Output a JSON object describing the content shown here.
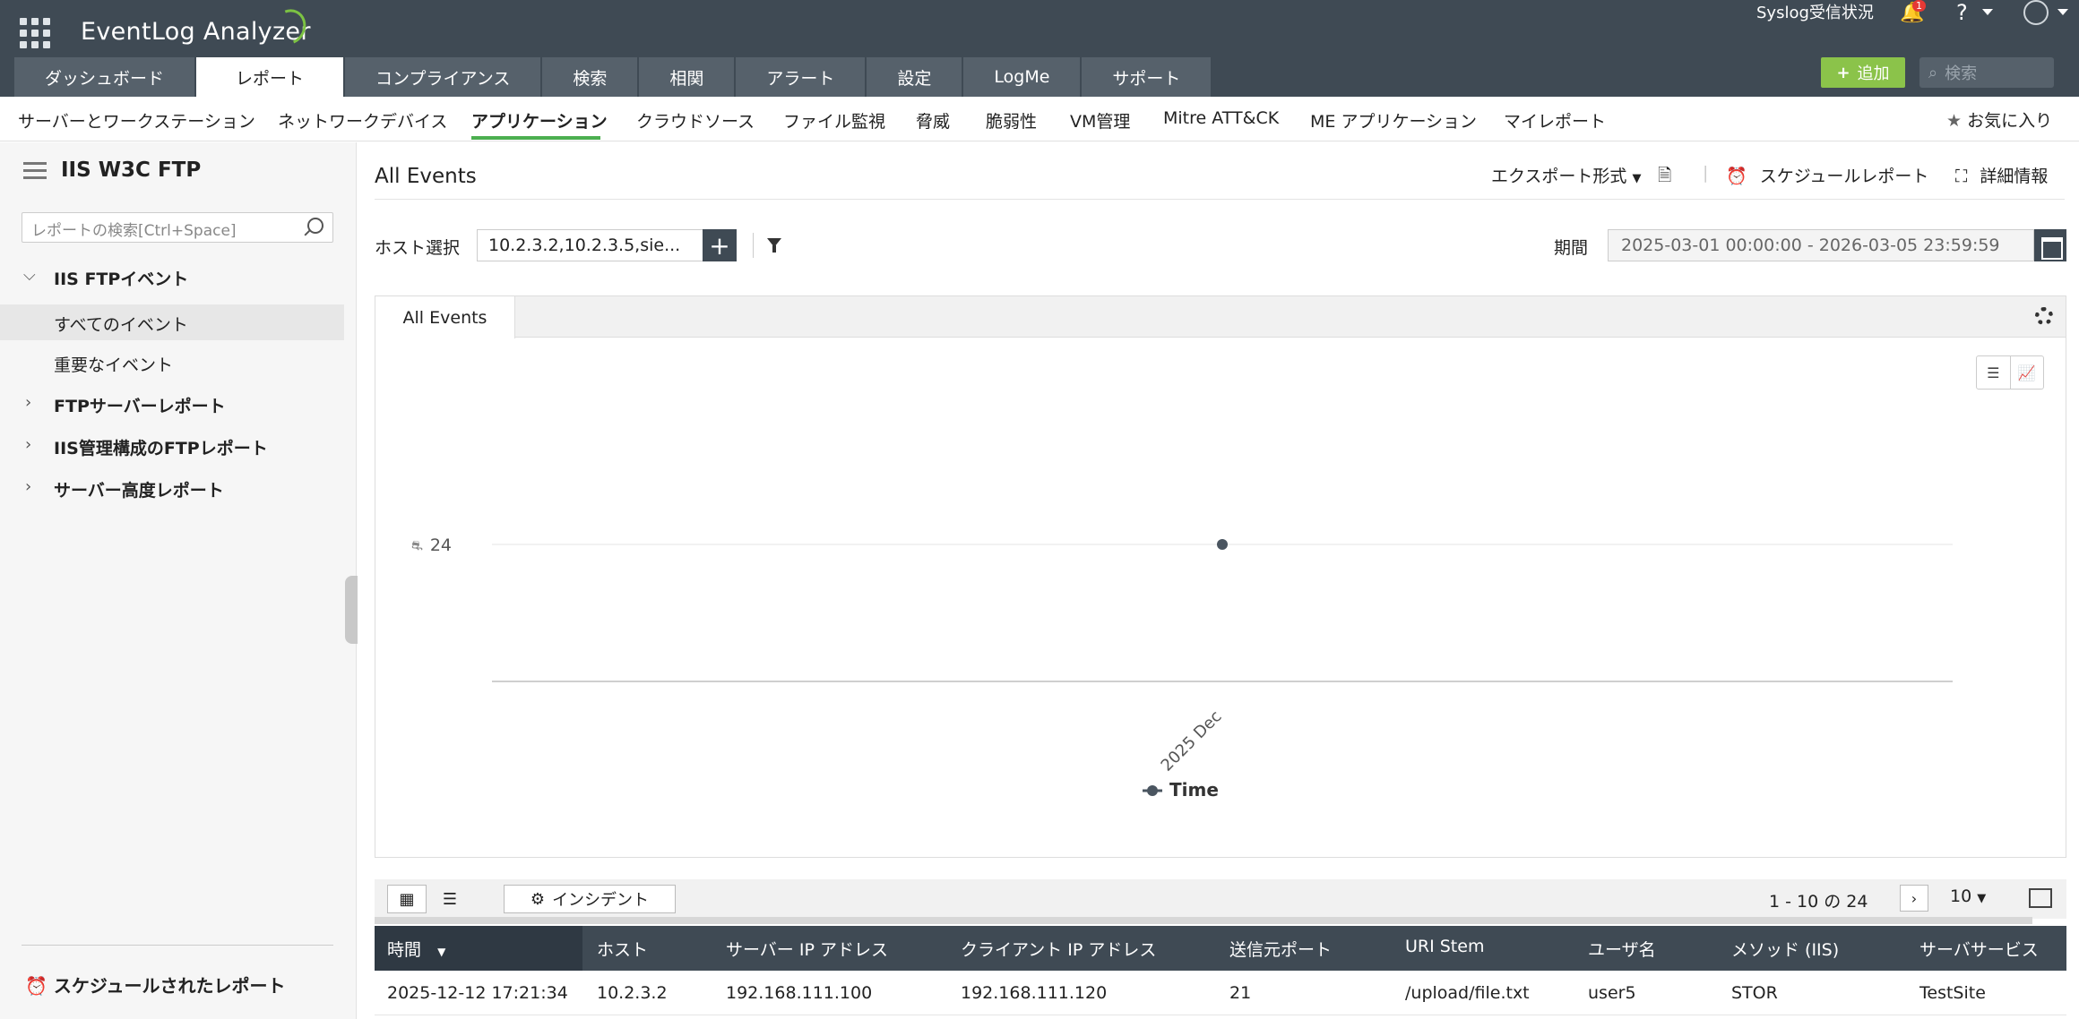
{
  "header": {
    "brand": "EventLog Analyzer",
    "syslog_status": "Syslog受信状況",
    "notification_count": "1",
    "help": "?",
    "add_label": "追加",
    "search_placeholder": "検索",
    "tabs": [
      {
        "label": "ダッシュボード"
      },
      {
        "label": "レポート"
      },
      {
        "label": "コンプライアンス"
      },
      {
        "label": "検索"
      },
      {
        "label": "相関"
      },
      {
        "label": "アラート"
      },
      {
        "label": "設定"
      },
      {
        "label": "LogMe"
      },
      {
        "label": "サポート"
      }
    ],
    "active_tab": "レポート"
  },
  "subnav": {
    "items": [
      {
        "label": "サーバーとワークステーション"
      },
      {
        "label": "ネットワークデバイス"
      },
      {
        "label": "アプリケーション"
      },
      {
        "label": "クラウドソース"
      },
      {
        "label": "ファイル監視"
      },
      {
        "label": "脅威"
      },
      {
        "label": "脆弱性"
      },
      {
        "label": "VM管理"
      },
      {
        "label": "Mitre ATT&CK"
      },
      {
        "label": "ME アプリケーション"
      },
      {
        "label": "マイレポート"
      }
    ],
    "active": "アプリケーション",
    "favorites": "お気に入り"
  },
  "sidebar": {
    "title": "IIS W3C FTP",
    "search_placeholder": "レポートの検索[Ctrl+Space]",
    "group_expanded": "IIS FTPイベント",
    "children": [
      {
        "label": "すべてのイベント"
      },
      {
        "label": "重要なイベント"
      }
    ],
    "groups_collapsed": [
      {
        "label": "FTPサーバーレポート"
      },
      {
        "label": "IIS管理構成のFTPレポート"
      },
      {
        "label": "サーバー高度レポート"
      }
    ],
    "scheduled": "スケジュールされたレポート"
  },
  "main": {
    "title": "All Events",
    "export": "エクスポート形式",
    "schedule": "スケジュールレポート",
    "details": "詳細情報",
    "host_label": "ホスト選択",
    "host_value": "10.2.3.2,10.2.3.5,sie...",
    "period_label": "期間",
    "period_value": "2025-03-01 00:00:00 - 2026-03-05 23:59:59",
    "chart_tab": "All Events",
    "incident_button": "インシデント",
    "pager": "1 - 10 の 24",
    "per_page": "10"
  },
  "chart_data": {
    "type": "line",
    "x": [
      "2025 Dec"
    ],
    "series": [
      {
        "name": "Time",
        "values": [
          24
        ]
      }
    ],
    "y_tick_labels": [
      "24"
    ],
    "legend": "bottom-center",
    "grid": true,
    "color": "#4a5560"
  },
  "table": {
    "columns": [
      "時間",
      "ホスト",
      "サーバー IP アドレス",
      "クライアント IP アドレス",
      "送信元ポート",
      "URI Stem",
      "ユーザ名",
      "メソッド (IIS)",
      "サーバサービス"
    ],
    "rows": [
      [
        "2025-12-12 17:21:34",
        "10.2.3.2",
        "192.168.111.100",
        "192.168.111.120",
        "21",
        "/upload/file.txt",
        "user5",
        "STOR",
        "TestSite"
      ]
    ]
  }
}
